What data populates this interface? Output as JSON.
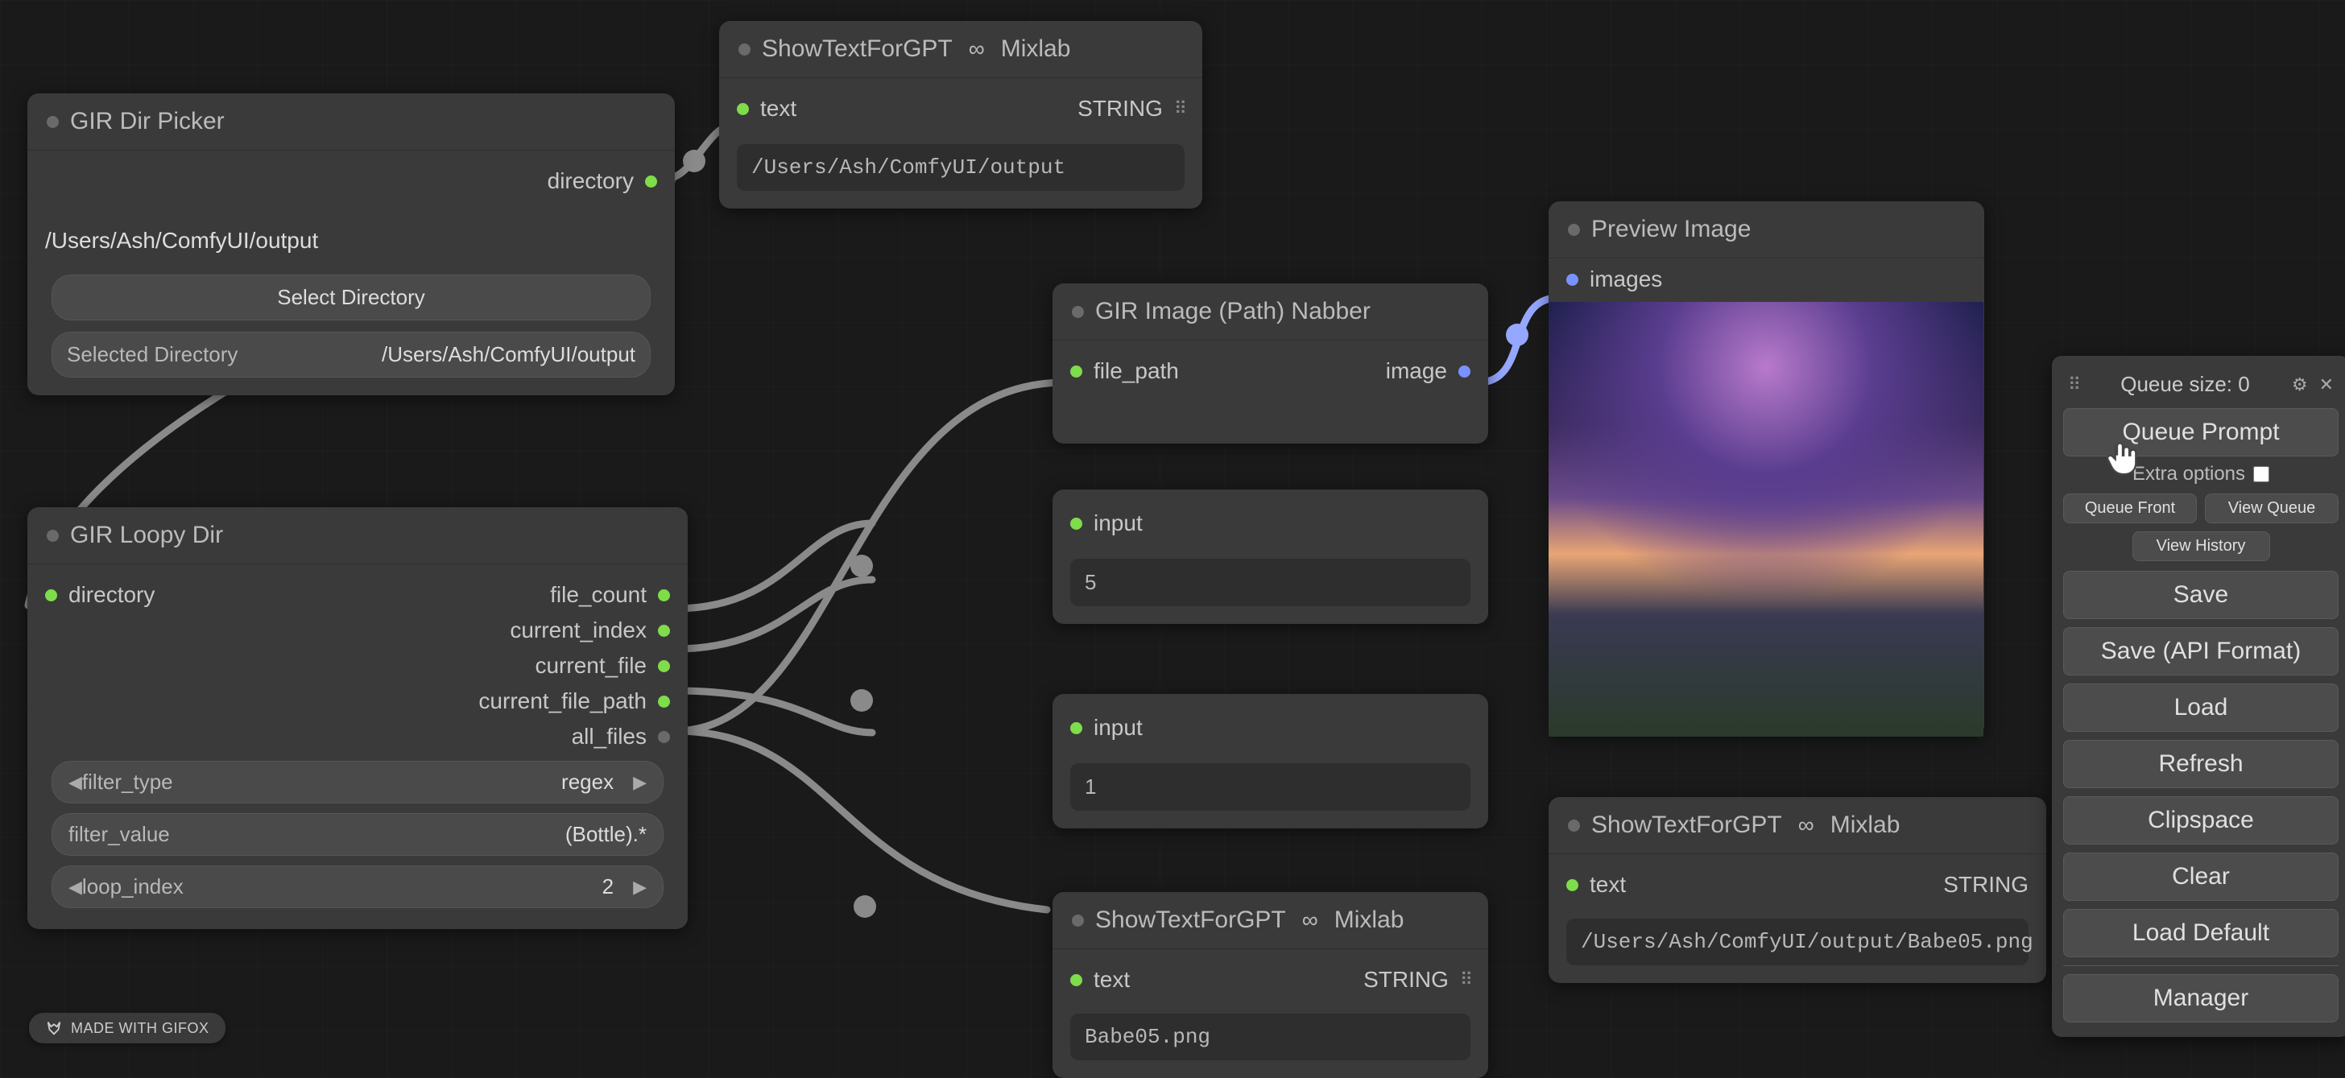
{
  "nodes": {
    "dir_picker": {
      "title": "GIR Dir Picker",
      "out_label": "directory",
      "path_value": "/Users/Ash/ComfyUI/output",
      "select_btn": "Select Directory",
      "selected_label": "Selected Directory",
      "selected_value": "/Users/Ash/ComfyUI/output"
    },
    "show_text_top": {
      "title_a": "ShowTextForGPT",
      "title_b": "Mixlab",
      "port_in": "text",
      "port_out": "STRING",
      "value": "/Users/Ash/ComfyUI/output"
    },
    "loopy": {
      "title": "GIR Loopy Dir",
      "in_label": "directory",
      "out1": "file_count",
      "out2": "current_index",
      "out3": "current_file",
      "out4": "current_file_path",
      "out5": "all_files",
      "w_filter_type_label": "filter_type",
      "w_filter_type_value": "regex",
      "w_filter_value_label": "filter_value",
      "w_filter_value_value": "(Bottle).*",
      "w_loop_index_label": "loop_index",
      "w_loop_index_value": "2"
    },
    "nabber": {
      "title": "GIR Image (Path) Nabber",
      "in_label": "file_path",
      "out_label": "image"
    },
    "input_a": {
      "port": "input",
      "value": "5"
    },
    "input_b": {
      "port": "input",
      "value": "1"
    },
    "show_text_mid": {
      "title_a": "ShowTextForGPT",
      "title_b": "Mixlab",
      "port_in": "text",
      "port_out": "STRING",
      "value": "Babe05.png"
    },
    "show_text_right": {
      "title_a": "ShowTextForGPT",
      "title_b": "Mixlab",
      "port_in": "text",
      "port_out": "STRING",
      "value": "/Users/Ash/ComfyUI/output/Babe05.png"
    },
    "preview": {
      "title": "Preview Image",
      "in_label": "images"
    }
  },
  "menu": {
    "queue_size_label": "Queue size: ",
    "queue_size_value": "0",
    "queue_prompt": "Queue Prompt",
    "extra_options": "Extra options",
    "queue_front": "Queue Front",
    "view_queue": "View Queue",
    "view_history": "View History",
    "save": "Save",
    "save_api": "Save (API Format)",
    "load": "Load",
    "refresh": "Refresh",
    "clipspace": "Clipspace",
    "clear": "Clear",
    "load_default": "Load Default",
    "manager": "Manager"
  },
  "badge": "MADE WITH GIFOX"
}
